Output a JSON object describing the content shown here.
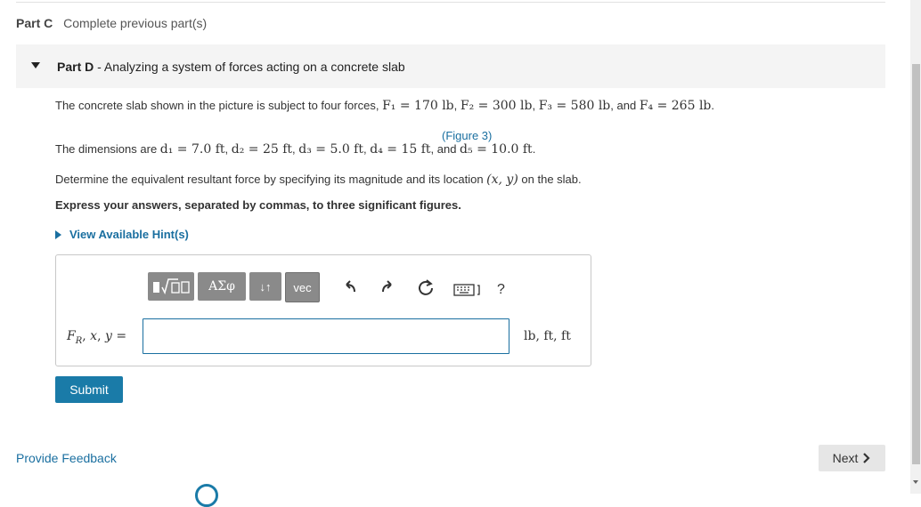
{
  "part_c": {
    "label": "Part C",
    "status": "Complete previous part(s)"
  },
  "part_d": {
    "label": "Part D",
    "separator": " - ",
    "title": "Analyzing a system of forces acting on a concrete slab"
  },
  "problem": {
    "line1_prefix": "The concrete slab shown in the picture is subject to four forces, ",
    "F1": "F₁ = 170 lb",
    "F2": "F₂ = 300 lb",
    "F3": "F₃ = 580 lb",
    "F4": "F₄ = 265 lb",
    "and": ", and ",
    "period": ".",
    "figure_link": "(Figure 3)",
    "line2_prefix": "The dimensions are ",
    "d1": "d₁ = 7.0 ft",
    "d2": "d₂ = 25 ft",
    "d3": "d₃ = 5.0 ft",
    "d4": "d₄ = 15 ft",
    "d5": "d₅ = 10.0 ft",
    "line3_prefix": "Determine the equivalent resultant force by specifying its magnitude and its location ",
    "line3_math": "(x, y)",
    "line3_suffix": " on the slab.",
    "instruction": "Express your answers, separated by commas, to three significant figures."
  },
  "hint": {
    "label": "View Available Hint(s)"
  },
  "toolbar": {
    "templates_label": "√□",
    "greek_label": "ΑΣφ",
    "arrows_label": "↓↑",
    "vec_label": "vec",
    "help_label": "?"
  },
  "answer": {
    "field_label": "F_R, x, y =",
    "input_value": "",
    "units": "lb, ft, ft"
  },
  "submit_label": "Submit",
  "feedback_label": "Provide Feedback",
  "next_label": "Next",
  "colors": {
    "link": "#1a6fa0",
    "button": "#1a7ba8",
    "toolbar": "#8a8a8a"
  }
}
